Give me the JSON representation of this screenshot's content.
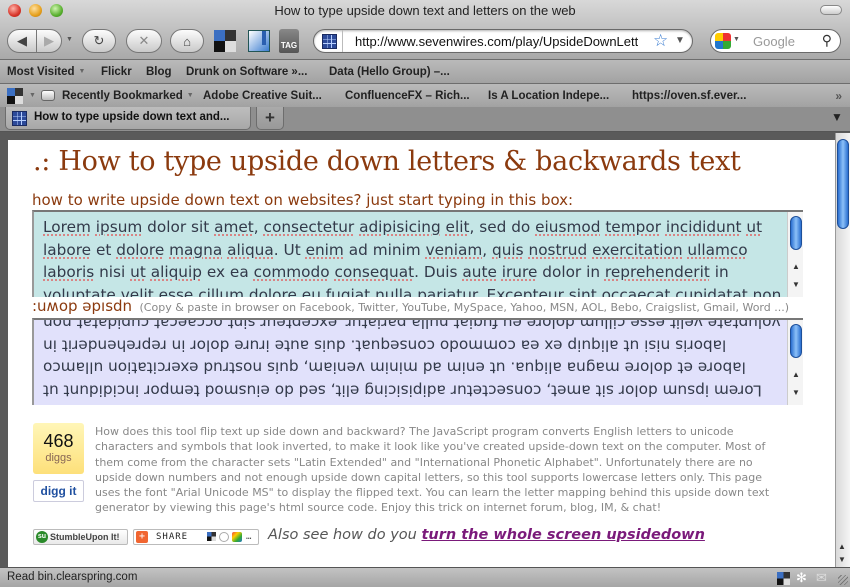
{
  "window": {
    "title": "How to type upside down text and letters on the web"
  },
  "toolbar": {
    "back_glyph": "◀",
    "forward_glyph": "▶",
    "reload_glyph": "↻",
    "stop_glyph": "✕",
    "home_glyph": "⌂",
    "tag_label": "TAG",
    "url": "http://www.sevenwires.com/play/UpsideDownLett",
    "star_glyph": "☆",
    "search_placeholder": "Google",
    "search_glyph": "⚲"
  },
  "bookmarks_bar": {
    "items": [
      {
        "label": "Most Visited",
        "dropdown": true
      },
      {
        "label": "Flickr"
      },
      {
        "label": "Blog"
      },
      {
        "label": "Drunk on Software »..."
      },
      {
        "label": "Data (Hello Group) –..."
      }
    ]
  },
  "bookmarks_bar_2": {
    "items": [
      {
        "label": "Recently Bookmarked",
        "dropdown": true
      },
      {
        "label": "Adobe Creative Suit..."
      },
      {
        "label": "ConfluenceFX – Rich..."
      },
      {
        "label": "Is A Location Indepe..."
      },
      {
        "label": "https://oven.sf.ever..."
      }
    ],
    "more_glyph": "»"
  },
  "tabs": {
    "items": [
      {
        "label": "How to type upside down text and...",
        "active": true
      }
    ],
    "new_tab_glyph": "+"
  },
  "page": {
    "title": ".: How to type upside down letters & backwards text",
    "prompt": "how to write upside down text on websites? just start typing in this box:",
    "input_text": "Lorem ipsum dolor sit amet, consectetur adipisicing elit, sed do eiusmod tempor incididunt ut labore et dolore magna aliqua. Ut enim ad minim veniam, quis nostrud exercitation ullamco laboris nisi ut aliquip ex ea commodo consequat. Duis aute irure dolor in reprehenderit in voluptate velit esse cillum dolore eu fugiat nulla pariatur. Excepteur sint occaecat cupidatat non proident, sunt in culpa qui officia deserunt mollit anim id est laborum.",
    "flip_label": "upside down:",
    "flip_label_rendered": ":uʍop ǝpısdn",
    "flip_note": "(Copy & paste in browser on Facebook, Twitter, YouTube, MySpace, Yahoo, MSN, AOL, Bebo, Craigslist, Gmail, Word ...)",
    "output_text": "Lorem ipsum dolor sit amet, consectetur adipisicing elit, sed do eiusmod tempor incididunt ut labore et dolore magna aliqua. ut enim ad minim veniam, quis nostrud exercitation ullamco laboris nisi ut aliquip ex ea commodo consequat. duis aute irure dolor in reprehenderit in voluptate velit esse cillum dolore eu fugiat nulla pariatur. excepteur sint occaecat cupidatat non proident, sunt in culpa qui officia deserunt mollit anim id est laborum.",
    "digg": {
      "count": "468",
      "count_label": "diggs",
      "button_label": "digg it"
    },
    "description": "How does this tool flip text up side down and backward? The JavaScript program converts English letters to unicode characters and symbols that look inverted, to make it look like you've created upside-down text on the computer. Most of them come from the character sets \"Latin Extended\" and \"International Phonetic Alphabet\". Unfortunately there are no upside down numbers and not enough upside down capital letters, so this tool supports lowercase letters only. This page uses the font \"Arial Unicode MS\" to display the flipped text. You can learn the letter mapping behind this upside down text generator by viewing this page's html source code. Enjoy this trick on internet forum, blog, IM, & chat!",
    "stumble_label": "StumbleUpon It!",
    "share_label": "SHARE",
    "also_see_prefix": "Also see how do you",
    "also_see_link": "turn the whole screen upsidedown"
  },
  "status": {
    "text": "Read bin.clearspring.com"
  }
}
